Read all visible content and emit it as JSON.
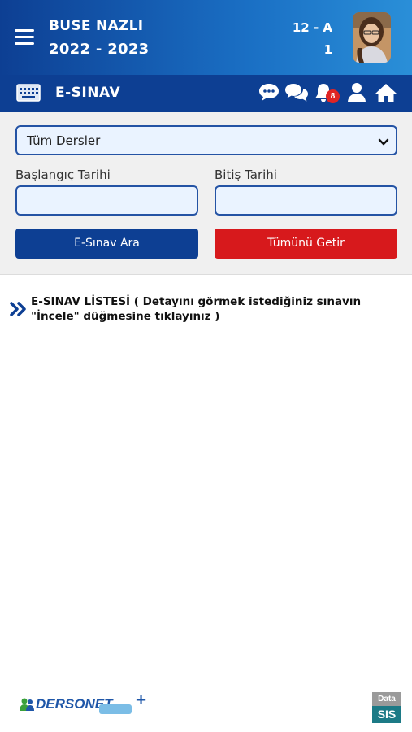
{
  "header": {
    "student_name": "BUSE NAZLI",
    "school_year": "2022 - 2023",
    "class_name": "12 - A",
    "student_number": "1"
  },
  "toolbar": {
    "title": "E-SINAV",
    "notification_count": "8",
    "icons": [
      "keyboard-icon",
      "chat-bubble-icon",
      "conversation-icon",
      "bell-icon",
      "user-icon",
      "home-icon"
    ]
  },
  "filter": {
    "course_select_value": "Tüm Dersler",
    "start_date_label": "Başlangıç Tarihi",
    "end_date_label": "Bitiş Tarihi",
    "start_date_value": "",
    "end_date_value": "",
    "search_button_label": "E-Sınav Ara",
    "get_all_button_label": "Tümünü Getir"
  },
  "list": {
    "heading": "E-SINAV LİSTESİ ( Detayını görmek istediğiniz sınavın \"İncele\" düğmesine tıklayınız )"
  },
  "footer": {
    "left_logo_text": "DERSONET",
    "right_logo_top": "Data",
    "right_logo_bottom": "SIS"
  },
  "colors": {
    "header_gradient_start": "#0d3f93",
    "header_gradient_end": "#2a8fd8",
    "toolbar": "#0d3f93",
    "primary_button": "#0d3f93",
    "danger_button": "#d7191c",
    "badge": "#e02424",
    "input_bg": "#eaf3ff",
    "input_border": "#2453a4"
  }
}
